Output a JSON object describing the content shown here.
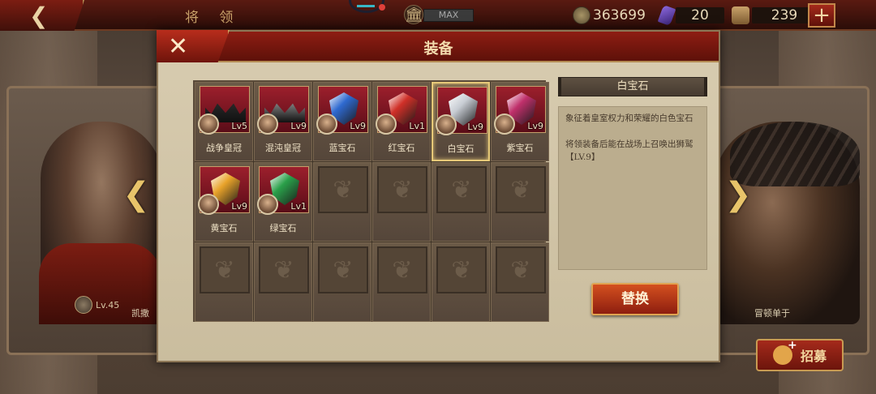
{
  "topbar": {
    "title": "将 领",
    "level_status": "MAX",
    "coins": "363699",
    "gems": "20",
    "food": "239"
  },
  "background": {
    "left_hero_level": "Lv.45",
    "left_hero_name": "凯撒",
    "right_hero_name": "冒顿单于",
    "recruit_label": "招募"
  },
  "modal": {
    "title": "装备",
    "equipment": [
      {
        "name": "战争皇冠",
        "level": "Lv5",
        "kind": "crown",
        "color": "#2a2a2a"
      },
      {
        "name": "混沌皇冠",
        "level": "Lv9",
        "kind": "crown",
        "color": "#8a8a8a"
      },
      {
        "name": "蓝宝石",
        "level": "Lv9",
        "kind": "gem",
        "color": "#2f6ad0"
      },
      {
        "name": "红宝石",
        "level": "Lv1",
        "kind": "gem",
        "color": "#d03028"
      },
      {
        "name": "白宝石",
        "level": "Lv9",
        "kind": "gem",
        "color": "#c7ccd3",
        "selected": true
      },
      {
        "name": "紫宝石",
        "level": "Lv9",
        "kind": "gem",
        "color": "#c0306b"
      },
      {
        "name": "黄宝石",
        "level": "Lv9",
        "kind": "gem",
        "color": "#e8a32a"
      },
      {
        "name": "绿宝石",
        "level": "Lv1",
        "kind": "gem",
        "color": "#2aa04a"
      }
    ],
    "empty_slots": 10,
    "detail": {
      "title": "白宝石",
      "description": "象征着皇室权力和荣耀的白色宝石",
      "effect": "将领装备后能在战场上召唤出狮鹫【LV.9】"
    },
    "replace_label": "替换"
  }
}
